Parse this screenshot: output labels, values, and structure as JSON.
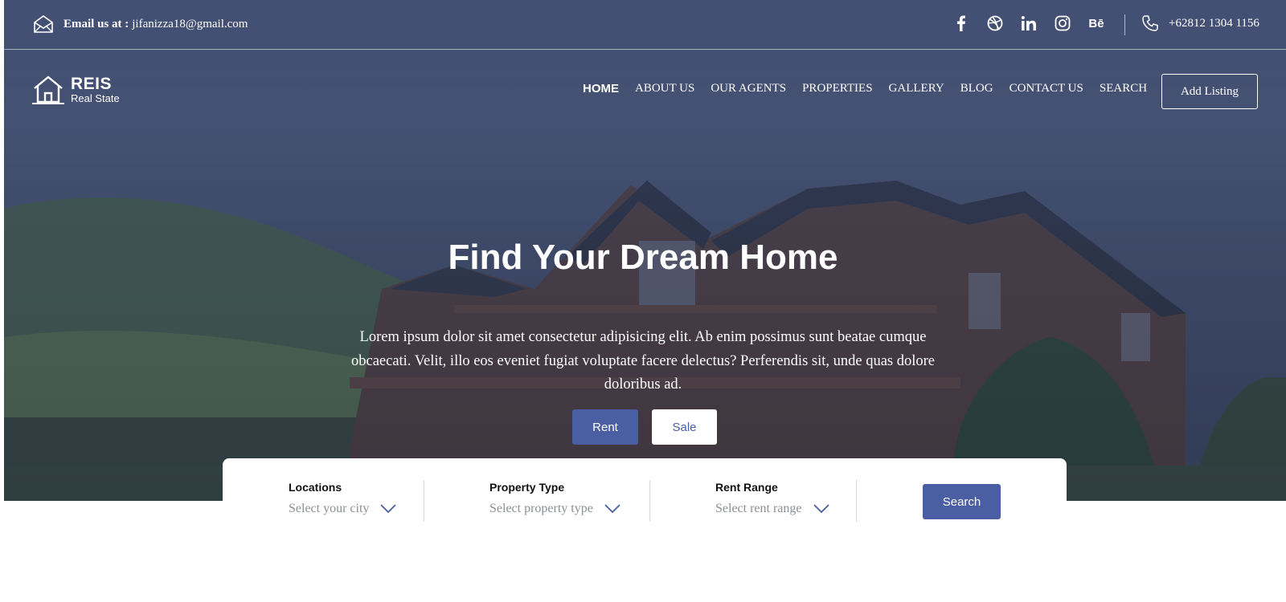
{
  "topbar": {
    "email_label": "Email us at :",
    "email_value": "jifanizza18@gmail.com",
    "phone": "+62812 1304 1156",
    "social_icons": [
      "facebook-icon",
      "dribbble-icon",
      "linkedin-icon",
      "instagram-icon",
      "behance-icon"
    ],
    "behance_text": "Bē"
  },
  "brand": {
    "name": "REIS",
    "tagline": "Real State"
  },
  "nav": {
    "items": [
      "HOME",
      "ABOUT US",
      "OUR AGENTS",
      "PROPERTIES",
      "GALLERY",
      "BLOG",
      "CONTACT US",
      "SEARCH"
    ],
    "active": "HOME",
    "cta": "Add Listing"
  },
  "hero": {
    "title": "Find Your Dream Home",
    "subtitle": "Lorem ipsum dolor sit amet consectetur adipisicing elit. Ab enim possimus sunt beatae cumque obcaecati. Velit, illo eos eveniet fugiat voluptate facere delectus? Perferendis sit, unde quas dolore doloribus ad.",
    "rent_button": "Rent",
    "sale_button": "Sale"
  },
  "search": {
    "fields": [
      {
        "label": "Locations",
        "value": "Select your city"
      },
      {
        "label": "Property Type",
        "value": "Select property type"
      },
      {
        "label": "Rent Range",
        "value": "Select rent range"
      }
    ],
    "button": "Search"
  },
  "colors": {
    "accent": "#4a5ea3",
    "overlay": "#3a486e",
    "white": "#ffffff"
  }
}
